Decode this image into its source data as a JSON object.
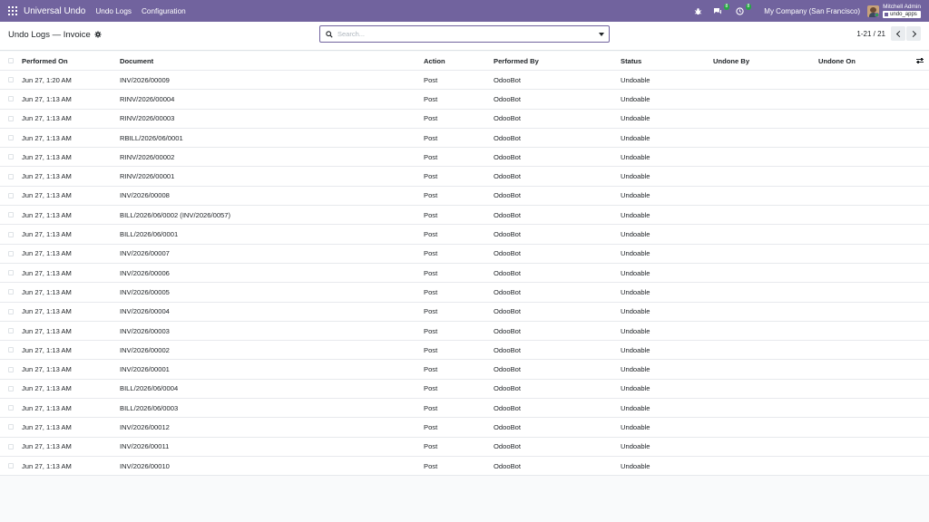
{
  "navbar": {
    "brand": "Universal Undo",
    "menu": [
      {
        "label": "Undo Logs"
      },
      {
        "label": "Configuration"
      }
    ],
    "messages_badge": "8",
    "activities_badge": "8",
    "company": "My Company (San Francisco)",
    "user_name": "Mitchell Admin",
    "database": "undo_apps"
  },
  "control_panel": {
    "title": "Undo Logs — Invoice",
    "search_placeholder": "Search...",
    "pager": "1-21 / 21"
  },
  "table": {
    "columns": {
      "performed_on": "Performed On",
      "document": "Document",
      "action": "Action",
      "performed_by": "Performed By",
      "status": "Status",
      "undone_by": "Undone By",
      "undone_on": "Undone On"
    },
    "rows": [
      {
        "performed_on": "Jun 27, 1:20 AM",
        "document": "INV/2026/00009",
        "action": "Post",
        "performed_by": "OdooBot",
        "status": "Undoable",
        "undone_by": "",
        "undone_on": ""
      },
      {
        "performed_on": "Jun 27, 1:13 AM",
        "document": "RINV/2026/00004",
        "action": "Post",
        "performed_by": "OdooBot",
        "status": "Undoable",
        "undone_by": "",
        "undone_on": ""
      },
      {
        "performed_on": "Jun 27, 1:13 AM",
        "document": "RINV/2026/00003",
        "action": "Post",
        "performed_by": "OdooBot",
        "status": "Undoable",
        "undone_by": "",
        "undone_on": ""
      },
      {
        "performed_on": "Jun 27, 1:13 AM",
        "document": "RBILL/2026/06/0001",
        "action": "Post",
        "performed_by": "OdooBot",
        "status": "Undoable",
        "undone_by": "",
        "undone_on": ""
      },
      {
        "performed_on": "Jun 27, 1:13 AM",
        "document": "RINV/2026/00002",
        "action": "Post",
        "performed_by": "OdooBot",
        "status": "Undoable",
        "undone_by": "",
        "undone_on": ""
      },
      {
        "performed_on": "Jun 27, 1:13 AM",
        "document": "RINV/2026/00001",
        "action": "Post",
        "performed_by": "OdooBot",
        "status": "Undoable",
        "undone_by": "",
        "undone_on": ""
      },
      {
        "performed_on": "Jun 27, 1:13 AM",
        "document": "INV/2026/00008",
        "action": "Post",
        "performed_by": "OdooBot",
        "status": "Undoable",
        "undone_by": "",
        "undone_on": ""
      },
      {
        "performed_on": "Jun 27, 1:13 AM",
        "document": "BILL/2026/06/0002 (INV/2026/0057)",
        "action": "Post",
        "performed_by": "OdooBot",
        "status": "Undoable",
        "undone_by": "",
        "undone_on": ""
      },
      {
        "performed_on": "Jun 27, 1:13 AM",
        "document": "BILL/2026/06/0001",
        "action": "Post",
        "performed_by": "OdooBot",
        "status": "Undoable",
        "undone_by": "",
        "undone_on": ""
      },
      {
        "performed_on": "Jun 27, 1:13 AM",
        "document": "INV/2026/00007",
        "action": "Post",
        "performed_by": "OdooBot",
        "status": "Undoable",
        "undone_by": "",
        "undone_on": ""
      },
      {
        "performed_on": "Jun 27, 1:13 AM",
        "document": "INV/2026/00006",
        "action": "Post",
        "performed_by": "OdooBot",
        "status": "Undoable",
        "undone_by": "",
        "undone_on": ""
      },
      {
        "performed_on": "Jun 27, 1:13 AM",
        "document": "INV/2026/00005",
        "action": "Post",
        "performed_by": "OdooBot",
        "status": "Undoable",
        "undone_by": "",
        "undone_on": ""
      },
      {
        "performed_on": "Jun 27, 1:13 AM",
        "document": "INV/2026/00004",
        "action": "Post",
        "performed_by": "OdooBot",
        "status": "Undoable",
        "undone_by": "",
        "undone_on": ""
      },
      {
        "performed_on": "Jun 27, 1:13 AM",
        "document": "INV/2026/00003",
        "action": "Post",
        "performed_by": "OdooBot",
        "status": "Undoable",
        "undone_by": "",
        "undone_on": ""
      },
      {
        "performed_on": "Jun 27, 1:13 AM",
        "document": "INV/2026/00002",
        "action": "Post",
        "performed_by": "OdooBot",
        "status": "Undoable",
        "undone_by": "",
        "undone_on": ""
      },
      {
        "performed_on": "Jun 27, 1:13 AM",
        "document": "INV/2026/00001",
        "action": "Post",
        "performed_by": "OdooBot",
        "status": "Undoable",
        "undone_by": "",
        "undone_on": ""
      },
      {
        "performed_on": "Jun 27, 1:13 AM",
        "document": "BILL/2026/06/0004",
        "action": "Post",
        "performed_by": "OdooBot",
        "status": "Undoable",
        "undone_by": "",
        "undone_on": ""
      },
      {
        "performed_on": "Jun 27, 1:13 AM",
        "document": "BILL/2026/06/0003",
        "action": "Post",
        "performed_by": "OdooBot",
        "status": "Undoable",
        "undone_by": "",
        "undone_on": ""
      },
      {
        "performed_on": "Jun 27, 1:13 AM",
        "document": "INV/2026/00012",
        "action": "Post",
        "performed_by": "OdooBot",
        "status": "Undoable",
        "undone_by": "",
        "undone_on": ""
      },
      {
        "performed_on": "Jun 27, 1:13 AM",
        "document": "INV/2026/00011",
        "action": "Post",
        "performed_by": "OdooBot",
        "status": "Undoable",
        "undone_by": "",
        "undone_on": ""
      },
      {
        "performed_on": "Jun 27, 1:13 AM",
        "document": "INV/2026/00010",
        "action": "Post",
        "performed_by": "OdooBot",
        "status": "Undoable",
        "undone_by": "",
        "undone_on": ""
      }
    ]
  },
  "colors": {
    "brand": "#71639e",
    "badge": "#28a745"
  },
  "icons": [
    "apps-grid-icon",
    "bug-icon",
    "chat-icon",
    "clock-icon",
    "gear-icon",
    "search-icon",
    "chevron-down-icon",
    "chevron-left-icon",
    "chevron-right-icon",
    "optional-columns-icon"
  ]
}
